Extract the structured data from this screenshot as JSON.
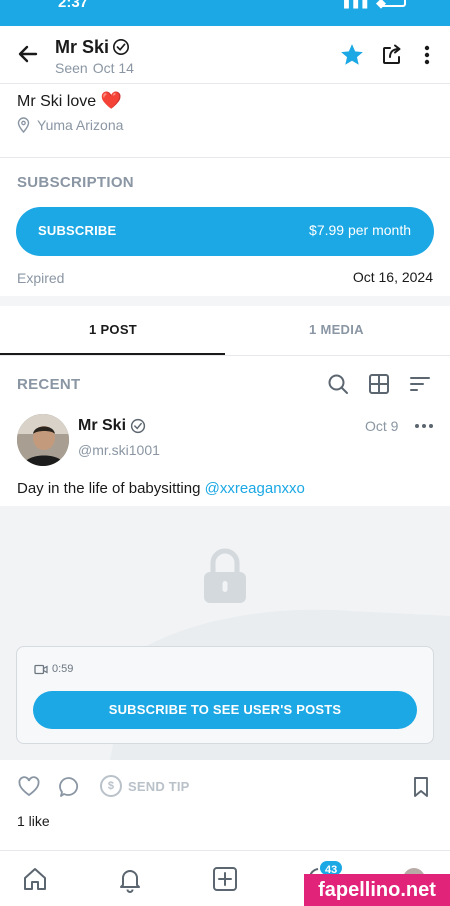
{
  "status_bar": {
    "time": "2:37",
    "accent": "#1ba8e4"
  },
  "header": {
    "name": "Mr Ski",
    "seen_label": "Seen",
    "seen_date": "Oct 14",
    "icons": [
      "back-arrow-icon",
      "verified-icon",
      "star-icon",
      "share-icon",
      "more-vertical-icon"
    ]
  },
  "profile": {
    "bio": "Mr Ski love",
    "bio_emoji": "❤️",
    "location": "Yuma Arizona"
  },
  "subscription": {
    "title": "SUBSCRIPTION",
    "button_label": "SUBSCRIBE",
    "price": "$7.99 per month",
    "status_label": "Expired",
    "status_date": "Oct 16, 2024"
  },
  "tabs": [
    {
      "label": "1 POST",
      "active": true
    },
    {
      "label": "1 MEDIA",
      "active": false
    }
  ],
  "feed": {
    "section_title": "RECENT",
    "tools": [
      "search-icon",
      "grid-icon",
      "sort-icon"
    ]
  },
  "post": {
    "author": "Mr Ski",
    "handle": "@mr.ski1001",
    "date": "Oct 9",
    "text": "Day in the life of babysitting",
    "mention": "@xxreaganxxo",
    "video_duration": "0:59",
    "locked_button": "SUBSCRIBE TO SEE USER'S POSTS",
    "tip_label": "SEND TIP",
    "tip_symbol": "$",
    "likes": "1 like"
  },
  "bottom_nav": {
    "items": [
      "home-icon",
      "bell-icon",
      "add-post-icon",
      "messages-icon",
      "profile-avatar"
    ],
    "messages_badge": "43"
  },
  "watermark": "fapellino.net",
  "colors": {
    "brand": "#1ba8e4",
    "muted": "#8a96a3",
    "heart": "#e0241b",
    "watermark": "#e2237a"
  }
}
